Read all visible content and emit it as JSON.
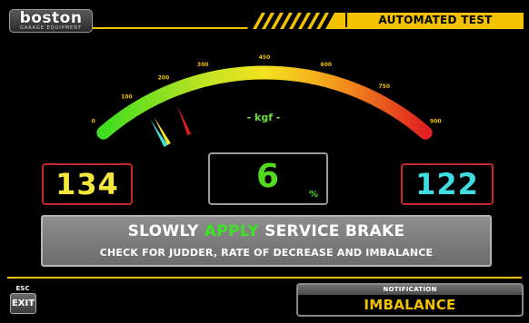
{
  "header": {
    "logo_word": "boston",
    "logo_sub": "GARAGE EQUIPMENT",
    "title": "AUTOMATED TEST"
  },
  "gauge": {
    "unit_label": "- kgf -",
    "min": 0,
    "max": 900,
    "ticks": [
      "0",
      "100",
      "200",
      "300",
      "450",
      "600",
      "750",
      "900"
    ],
    "tick_values": [
      0,
      100,
      200,
      300,
      450,
      600,
      750,
      900
    ],
    "needles": [
      {
        "name": "left",
        "value": 134,
        "color": "#f5e63b"
      },
      {
        "name": "right",
        "value": 122,
        "color": "#3fdde0"
      },
      {
        "name": "peak",
        "value": 205,
        "color": "#d61c1c"
      }
    ]
  },
  "readouts": {
    "left": "134",
    "center": "6",
    "center_unit": "%",
    "right": "122"
  },
  "instruction": {
    "line1_prefix": "SLOWLY ",
    "line1_highlight": "APPLY",
    "line1_suffix": " SERVICE BRAKE",
    "line2": "CHECK FOR JUDDER, RATE OF DECREASE AND IMBALANCE"
  },
  "footer": {
    "esc_label": "ESC",
    "exit_label": "EXIT",
    "notification_label": "NOTIFICATION",
    "notification_message": "IMBALANCE"
  },
  "colors": {
    "accent": "#f2c200",
    "readout_border": "#c6262e",
    "left_value": "#f5e63b",
    "right_value": "#3fdde0",
    "center_value": "#52dc1f"
  }
}
